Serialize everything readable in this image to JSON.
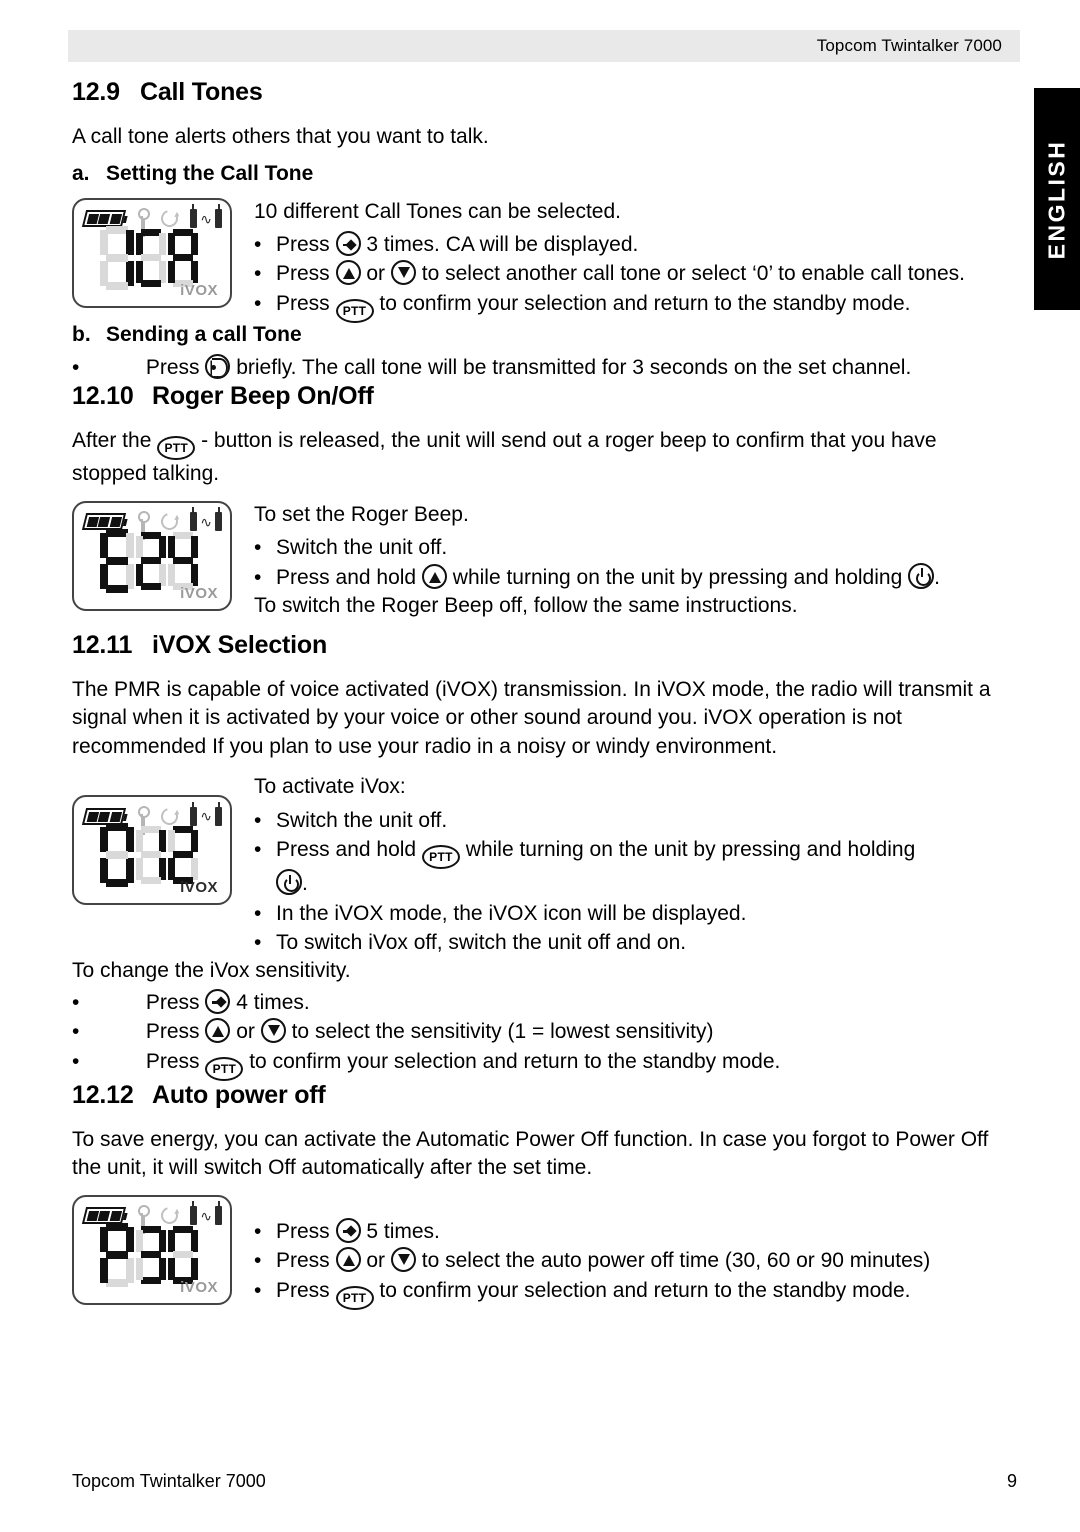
{
  "header": {
    "title": "Topcom Twintalker 7000"
  },
  "language_tab": {
    "label": "ENGLISH"
  },
  "footer": {
    "left": "Topcom Twintalker 7000",
    "page_number": "9"
  },
  "sections": {
    "call_tones": {
      "number": "12.9",
      "title": "Call Tones",
      "intro": "A call tone alerts others that you want to talk.",
      "sub_a": {
        "letter": "a.",
        "title": "Setting the Call Tone",
        "lead": "10 different Call Tones can be selected.",
        "b1_pre": "Press",
        "b1_post": "3 times. CA will be displayed.",
        "b2_pre": "Press",
        "b2_mid": "or",
        "b2_post": "to select another call tone or select ‘0’ to enable call tones.",
        "b3_pre": "Press",
        "b3_post": "to confirm your selection and return to the standby mode."
      },
      "sub_b": {
        "letter": "b.",
        "title": "Sending a call Tone",
        "b1_pre": "Press",
        "b1_post": "briefly. The call tone will be transmitted for 3 seconds on the set channel."
      },
      "lcd": {
        "digits": "1 CA",
        "ivox_label": "iVOX",
        "ivox_active": false
      }
    },
    "roger_beep": {
      "number": "12.10",
      "title": "Roger Beep On/Off",
      "intro_pre": "After the",
      "intro_post": "- button is released, the unit will send out a roger beep to confirm that you have stopped talking.",
      "lead": "To set the Roger Beep.",
      "b1": "Switch the unit off.",
      "b2_pre": "Press and hold",
      "b2_mid": "while turning on the unit by pressing and holding",
      "b2_post": ".",
      "closing": "To switch the Roger Beep off, follow the same instructions.",
      "lcd": {
        "digits": "r 24",
        "ivox_label": "iVOX",
        "ivox_active": false
      }
    },
    "ivox_selection": {
      "number": "12.11",
      "title": "iVOX Selection",
      "intro": "The PMR is capable of voice activated (iVOX) transmission. In iVOX mode, the radio will transmit a signal when it is activated by your voice or other sound around you. iVOX operation is not recommended If you plan to use your radio in a noisy or windy environment.",
      "lead": "To activate iVox:",
      "b1": "Switch the unit off.",
      "b2_pre": "Press and hold",
      "b2_mid": "while turning on the unit by pressing and holding",
      "b2_post": ".",
      "b3": "In the iVOX mode, the iVOX icon will be displayed.",
      "b4": "To switch iVox off, switch the unit off and on.",
      "sensitivity_lead": "To change the iVox sensitivity.",
      "s1_pre": "Press",
      "s1_post": "4 times.",
      "s2_pre": "Press",
      "s2_mid": "or",
      "s2_post": "to select the sensitivity (1 = lowest sensitivity)",
      "s3_pre": "Press",
      "s3_post": "to confirm your selection and return to the standby mode.",
      "lcd": {
        "digits": "12",
        "ivox_label": "iVOX",
        "ivox_active": true
      }
    },
    "auto_power_off": {
      "number": "12.12",
      "title": "Auto power off",
      "intro": "To save energy, you can activate the Automatic Power Off function. In case you forgot to Power Off the unit, it will switch Off automatically after the set time.",
      "b1_pre": "Press",
      "b1_post": "5 times.",
      "b2_pre": "Press",
      "b2_mid": "or",
      "b2_post": "to select the auto power off time (30, 60 or 90 minutes)",
      "b3_pre": "Press",
      "b3_post": "to confirm your selection and return to the standby mode.",
      "lcd": {
        "digits": "P 30",
        "ivox_label": "iVOX",
        "ivox_active": false
      }
    }
  },
  "bullet_char": "•",
  "icons": {
    "menu": "menu-scan-icon",
    "up": "up-arrow-icon",
    "down": "down-arrow-icon",
    "ptt": "ptt-button-icon",
    "call": "call-tone-icon",
    "power": "power-button-icon",
    "battery": "battery-icon",
    "key": "key-lock-icon",
    "loop": "scan-loop-icon",
    "radios": "dual-radio-icon"
  }
}
